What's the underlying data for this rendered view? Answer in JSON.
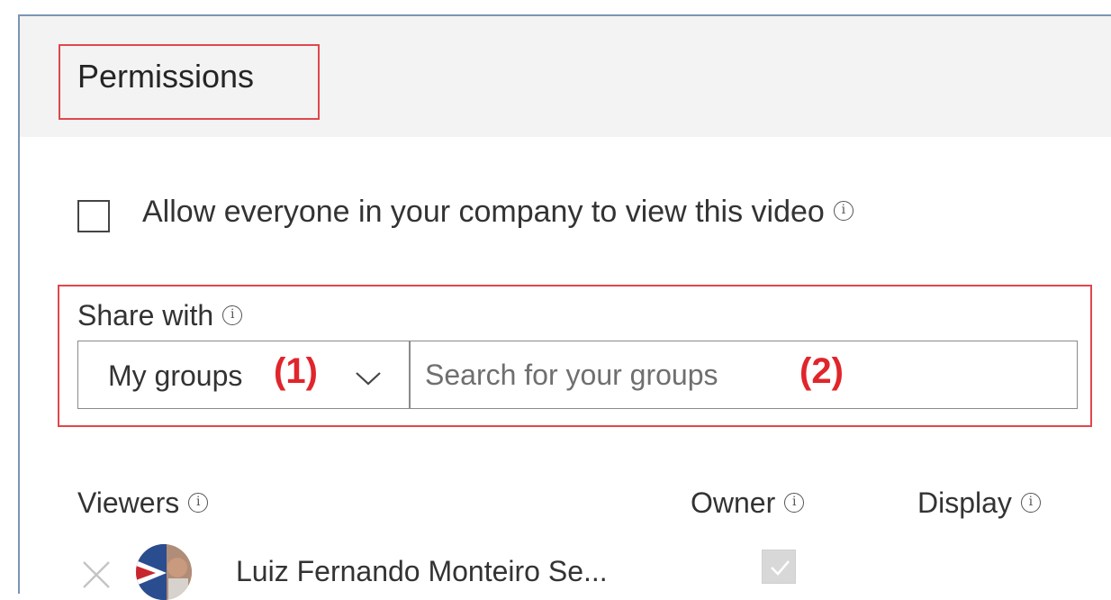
{
  "header": {
    "title": "Permissions"
  },
  "allow_all": {
    "checked": false,
    "label": "Allow everyone in your company to view this video"
  },
  "share": {
    "label": "Share with",
    "dropdown_value": "My groups",
    "search_placeholder": "Search for your groups",
    "marker_dropdown": "(1)",
    "marker_search": "(2)"
  },
  "viewers": {
    "columns": {
      "viewers": "Viewers",
      "owner": "Owner",
      "display": "Display"
    },
    "rows": [
      {
        "name": "Luiz Fernando Monteiro Se...",
        "owner": true
      }
    ]
  },
  "icons": {
    "info": "info-icon",
    "chevron": "chevron-down-icon",
    "remove": "close-icon",
    "check": "checkmark-icon"
  },
  "colors": {
    "callout": "#e0474c",
    "marker": "#e0252b",
    "header_band": "#f3f3f3",
    "frame": "#7a95b3"
  }
}
